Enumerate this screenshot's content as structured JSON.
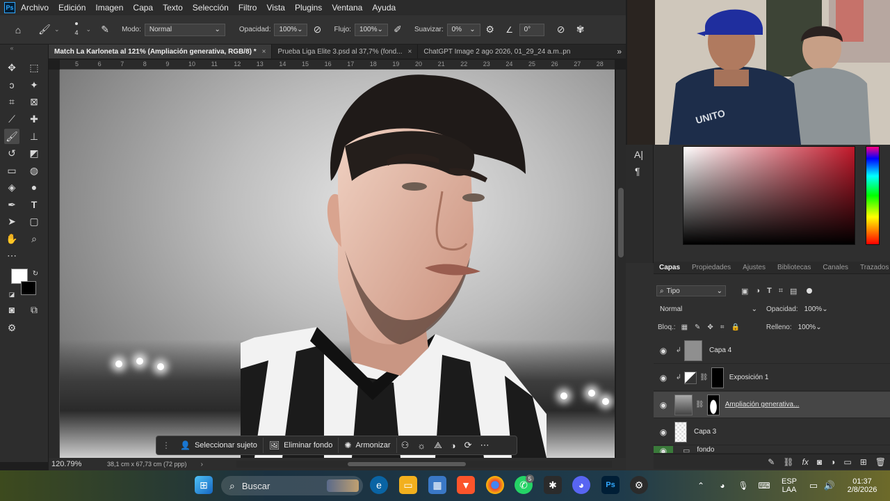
{
  "menu": {
    "logo": "Ps",
    "items": [
      "Archivo",
      "Edición",
      "Imagen",
      "Capa",
      "Texto",
      "Selección",
      "Filtro",
      "Vista",
      "Plugins",
      "Ventana",
      "Ayuda"
    ]
  },
  "options": {
    "brush_size": "4",
    "mode_label": "Modo:",
    "mode_value": "Normal",
    "opacity_label": "Opacidad:",
    "opacity_value": "100%",
    "flow_label": "Flujo:",
    "flow_value": "100%",
    "smooth_label": "Suavizar:",
    "smooth_value": "0%",
    "angle_value": "0°"
  },
  "tabs": [
    {
      "label": "Match La Karloneta al 121% (Ampliación generativa, RGB/8) *",
      "active": true
    },
    {
      "label": "Prueba Liga Elite 3.psd al 37,7% (fond...",
      "active": false
    },
    {
      "label": "ChatGPT Image 2 ago 2026, 01_29_24 a.m..pn",
      "active": false
    }
  ],
  "ruler": [
    "5",
    "6",
    "7",
    "8",
    "9",
    "10",
    "11",
    "12",
    "13",
    "14",
    "15",
    "16",
    "17",
    "18",
    "19",
    "20",
    "21",
    "22",
    "23",
    "24",
    "25",
    "26",
    "27",
    "28"
  ],
  "context_bar": {
    "select_subject": "Seleccionar sujeto",
    "remove_bg": "Eliminar fondo",
    "harmonize": "Armonizar"
  },
  "status": {
    "zoom": "120.79%",
    "doc_info": "38,1 cm x 67,73 cm (72 ppp)"
  },
  "layers_panel": {
    "tabs": [
      "Capas",
      "Propiedades",
      "Ajustes",
      "Bibliotecas",
      "Canales",
      "Trazados"
    ],
    "filter_label": "Tipo",
    "blend_mode": "Normal",
    "opacity_label": "Opacidad:",
    "opacity_value": "100%",
    "lock_label": "Bloq.:",
    "fill_label": "Relleno:",
    "fill_value": "100%",
    "layers": [
      {
        "name": "Capa 4",
        "active": false
      },
      {
        "name": "Exposición 1",
        "active": false
      },
      {
        "name": "Ampliación generativa...",
        "active": true
      },
      {
        "name": "Capa 3",
        "active": false
      },
      {
        "name": "fondo",
        "active": false
      }
    ]
  },
  "taskbar": {
    "search_label": "Buscar",
    "lang_top": "ESP",
    "lang_bottom": "LAA",
    "time": "01:37",
    "date": "2/8/2026",
    "whatsapp_badge": "5"
  },
  "colors": {
    "accent": "#31a8ff",
    "foreground_swatch": "#ffffff",
    "background_swatch": "#000000"
  }
}
